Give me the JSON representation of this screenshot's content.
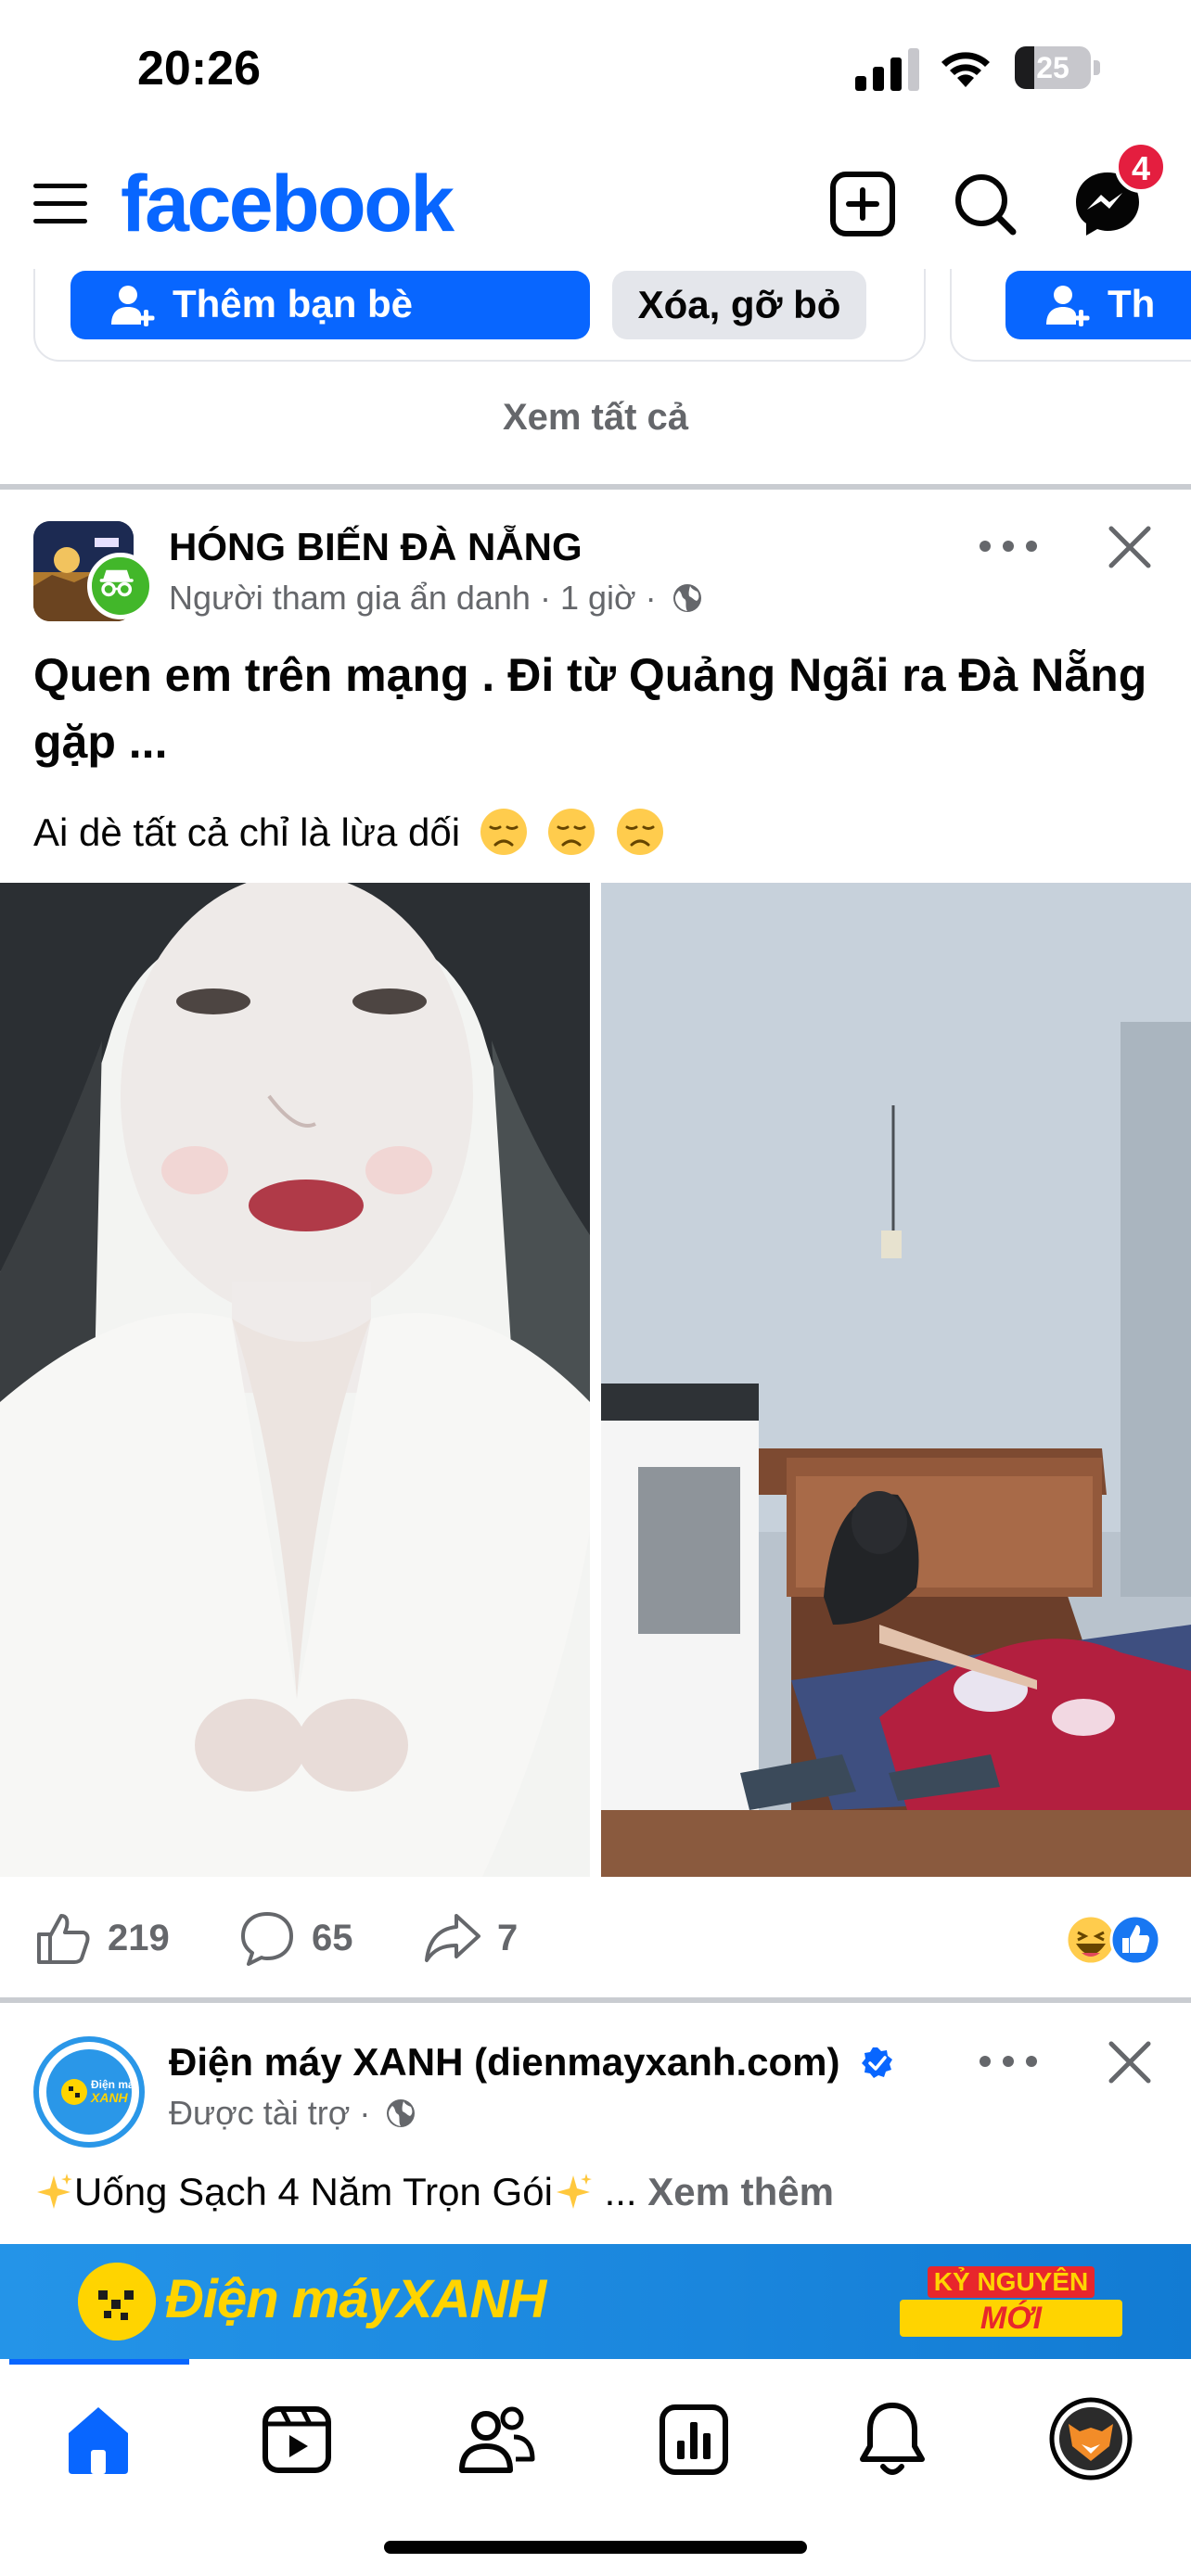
{
  "status_bar": {
    "time": "20:26",
    "battery_level": "25",
    "battery_fraction": 0.25
  },
  "top_nav": {
    "brand": "facebook",
    "brand_color": "#0866ff",
    "icons": [
      "menu-icon",
      "create-post-icon",
      "search-icon",
      "messenger-icon"
    ],
    "messenger_badge": "4"
  },
  "people_you_may_know": {
    "add_friend_label": "Thêm bạn bè",
    "remove_label": "Xóa, gỡ bỏ",
    "add_friend_label_partial": "Th",
    "see_all": "Xem tất cả"
  },
  "post": {
    "group_name": "HÓNG BIẾN ĐÀ NẴNG",
    "author": "Người tham gia ẩn danh",
    "separator": "·",
    "time": "1 giờ",
    "privacy_icon": "globe-icon",
    "headline": "Quen em trên mạng . Đi từ Quảng Ngãi ra Đà Nẵng gặp ...",
    "body": "Ai dè tất cả chỉ là lừa dối",
    "body_emoji": [
      "disappointed-face",
      "disappointed-face",
      "disappointed-face"
    ],
    "stats": {
      "likes": "219",
      "comments": "65",
      "shares": "7"
    },
    "reaction_icons": [
      "haha-icon",
      "like-icon"
    ]
  },
  "ad": {
    "advertiser": "Điện máy XANH (dienmayxanh.com)",
    "sponsored": "Được tài trợ",
    "separator": "·",
    "text": "Uống Sạch 4 Năm Trọn Gói",
    "ellipsis": "...",
    "see_more": "Xem thêm",
    "banner_brand_1": "Điện máy",
    "banner_brand_2": "XANH",
    "banner_slogan_top": "KỶ NGUYÊN",
    "banner_slogan_main": "MỚI",
    "avatar_logo_1": "Điện máy",
    "avatar_logo_2": "XANH"
  },
  "tab_bar": {
    "tabs": [
      "home",
      "video",
      "friends",
      "feeds",
      "notifications",
      "profile"
    ],
    "active": "home"
  }
}
